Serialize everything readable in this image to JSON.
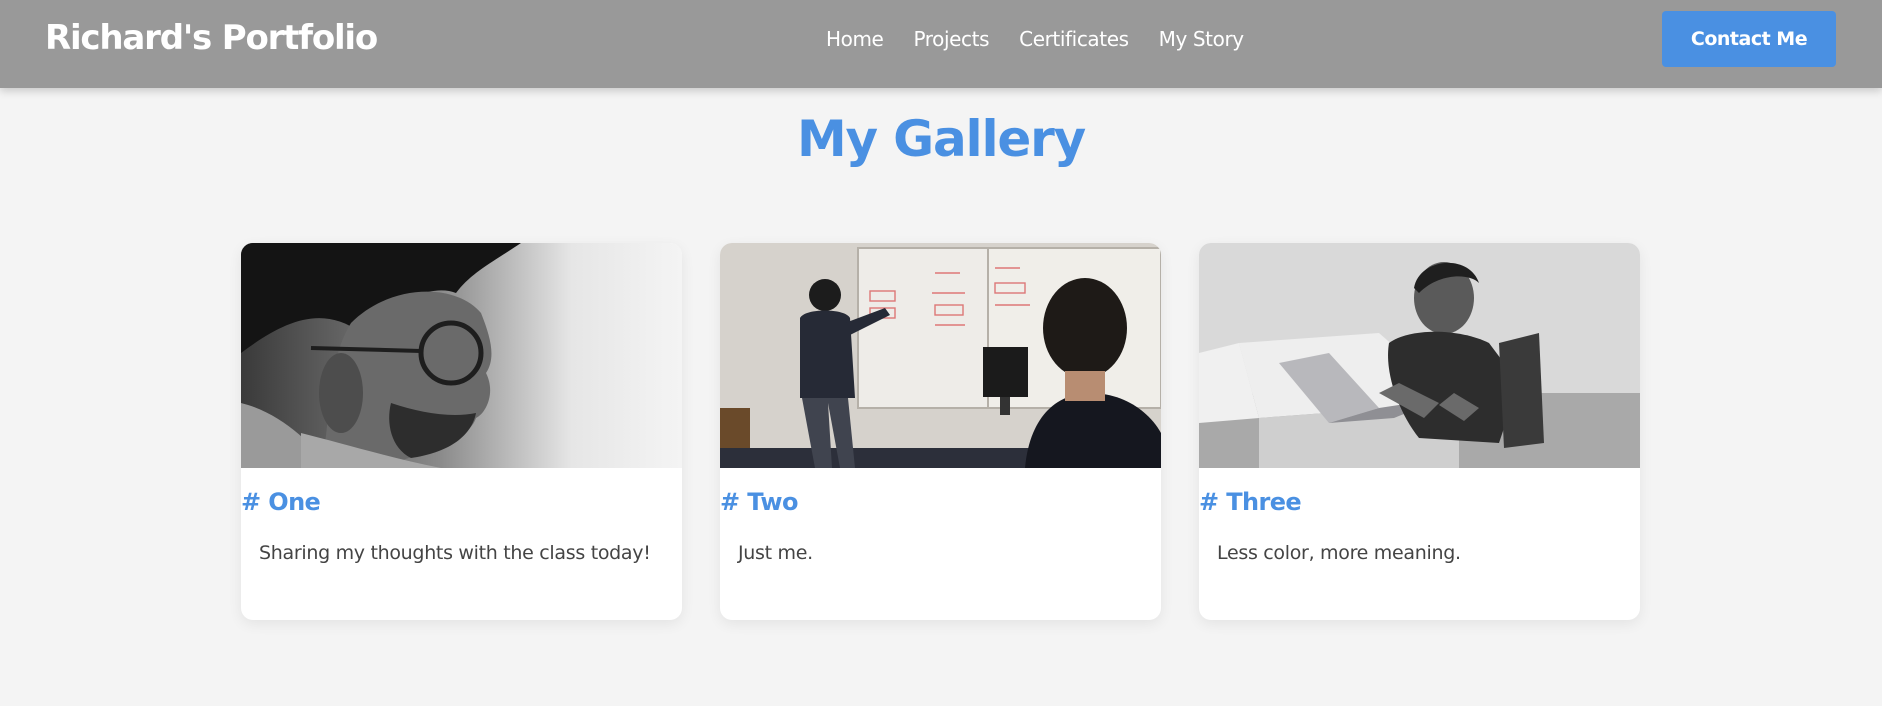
{
  "header": {
    "brand": "Richard's Portfolio",
    "nav": [
      "Home",
      "Projects",
      "Certificates",
      "My Story"
    ],
    "contact_label": "Contact Me"
  },
  "main": {
    "title": "My Gallery",
    "cards": [
      {
        "heading": "# One",
        "text": "Sharing my thoughts with the class today!"
      },
      {
        "heading": "# Two",
        "text": "Just me."
      },
      {
        "heading": "# Three",
        "text": "Less color, more meaning."
      }
    ]
  },
  "colors": {
    "accent": "#4a90e2",
    "navbar": "#999999",
    "background": "#f4f4f4",
    "body_text": "#444444"
  },
  "icons": [
    "portrait-photo",
    "whiteboard-photo",
    "laptop-photo"
  ]
}
